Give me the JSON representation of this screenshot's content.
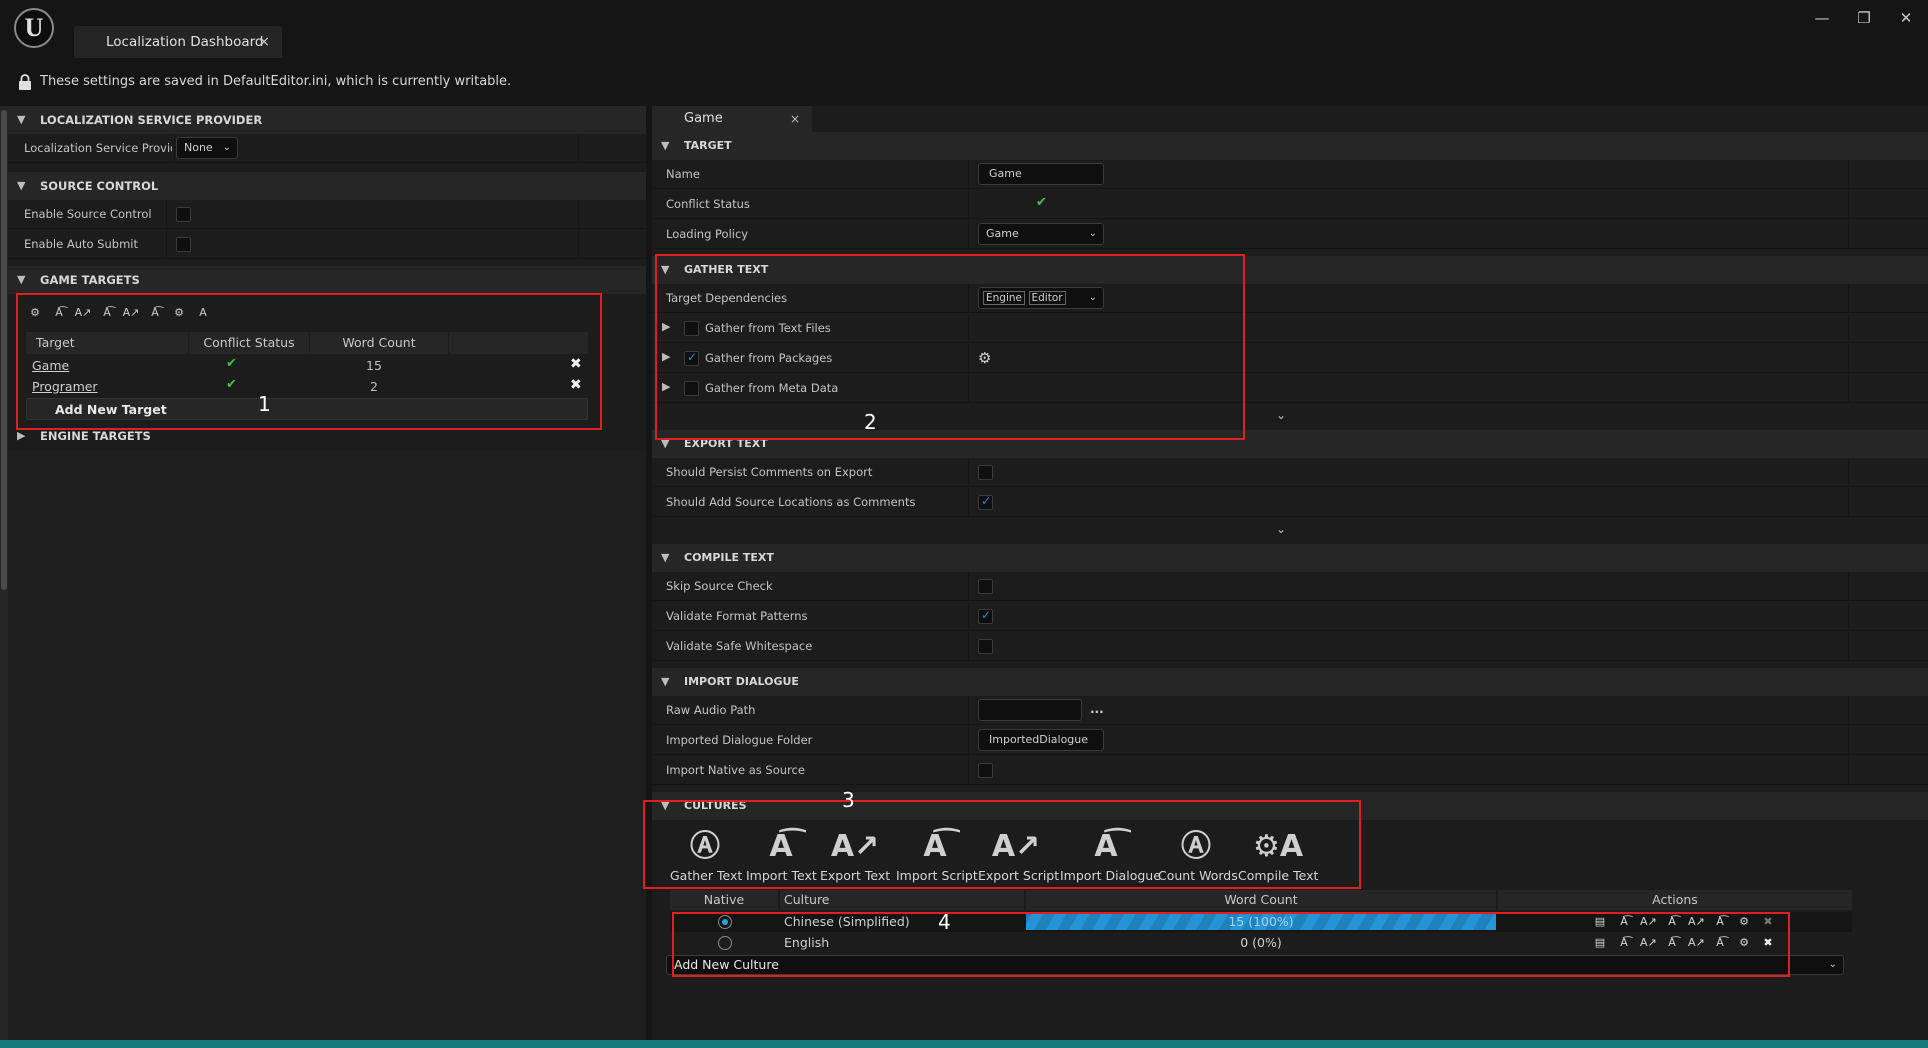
{
  "window": {
    "tab_title": "Localization Dashboard",
    "tab_close": "×",
    "minimize": "—",
    "restore": "❐",
    "close": "✕"
  },
  "info_bar": {
    "message": "These settings are saved in DefaultEditor.ini, which is currently writable."
  },
  "left": {
    "sections": {
      "service_provider": "LOCALIZATION SERVICE PROVIDER",
      "source_control": "SOURCE CONTROL",
      "game_targets": "GAME TARGETS",
      "engine_targets": "ENGINE TARGETS"
    },
    "service_provider_label": "Localization Service Provider",
    "service_provider_value": "None",
    "enable_source_control": {
      "label": "Enable Source Control",
      "checked": false
    },
    "enable_auto_submit": {
      "label": "Enable Auto Submit",
      "checked": false
    },
    "targets_table": {
      "headers": [
        "Target",
        "Conflict Status",
        "Word Count"
      ],
      "rows": [
        {
          "name": "Game",
          "status": "✔",
          "word_count": "15",
          "delete": "✖"
        },
        {
          "name": "Programer",
          "status": "✔",
          "word_count": "2",
          "delete": "✖"
        }
      ],
      "add_button": "Add New Target"
    }
  },
  "right": {
    "tab": {
      "label": "Game",
      "close": "×"
    },
    "sections": {
      "target": "TARGET",
      "gather_text": "GATHER TEXT",
      "export_text": "EXPORT TEXT",
      "compile_text": "COMPILE TEXT",
      "import_dialogue": "IMPORT DIALOGUE",
      "cultures": "CULTURES"
    },
    "target": {
      "name_label": "Name",
      "name_value": "Game",
      "conflict_label": "Conflict Status",
      "conflict_value": "✔",
      "loading_label": "Loading Policy",
      "loading_value": "Game"
    },
    "gather": {
      "deps_label": "Target Dependencies",
      "deps_values": [
        "Engine",
        "Editor"
      ],
      "text_files": {
        "label": "Gather from Text Files",
        "checked": false
      },
      "packages": {
        "label": "Gather from Packages",
        "checked": true
      },
      "meta_data": {
        "label": "Gather from Meta Data",
        "checked": false
      }
    },
    "export": {
      "persist_comments": {
        "label": "Should Persist Comments on Export",
        "checked": false
      },
      "source_locations": {
        "label": "Should Add Source Locations as Comments",
        "checked": true
      }
    },
    "compile": {
      "skip_source_check": {
        "label": "Skip Source Check",
        "checked": false
      },
      "validate_format": {
        "label": "Validate Format Patterns",
        "checked": true
      },
      "validate_whitespace": {
        "label": "Validate Safe Whitespace",
        "checked": false
      }
    },
    "import_dialogue": {
      "raw_audio_label": "Raw Audio Path",
      "raw_audio_value": "",
      "browse": "...",
      "folder_label": "Imported Dialogue Folder",
      "folder_value": "ImportedDialogue",
      "native_as_source": {
        "label": "Import Native as Source",
        "checked": false
      }
    },
    "cultures": {
      "tools": [
        "Gather Text",
        "Import Text",
        "Export Text",
        "Import Script",
        "Export Script",
        "Import Dialogue",
        "Count Words",
        "Compile Text"
      ],
      "headers": [
        "Native",
        "Culture",
        "Word Count",
        "Actions"
      ],
      "rows": [
        {
          "native": true,
          "culture": "Chinese (Simplified)",
          "word_count": "15 (100%)",
          "progress": 1.0
        },
        {
          "native": false,
          "culture": "English",
          "word_count": "0 (0%)",
          "progress": 0.0
        }
      ],
      "add_culture": "Add New Culture"
    }
  },
  "annotations": [
    "1",
    "2",
    "3",
    "4"
  ],
  "colors": {
    "highlight": "#e02020",
    "accent": "#2593d4",
    "ok": "#3fc43f"
  }
}
